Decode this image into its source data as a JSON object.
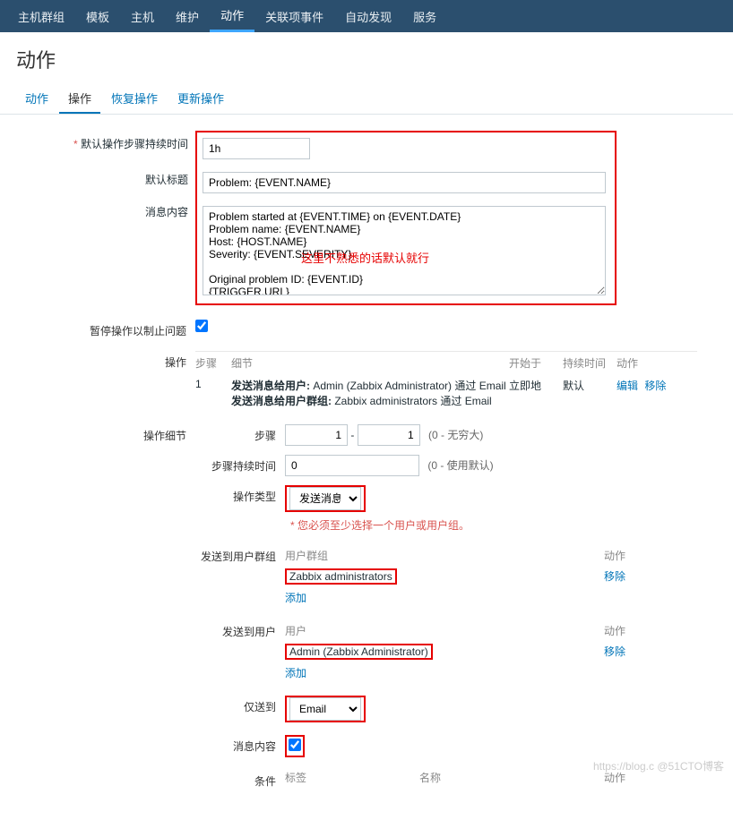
{
  "nav": {
    "items": [
      "主机群组",
      "模板",
      "主机",
      "维护",
      "动作",
      "关联项事件",
      "自动发现",
      "服务"
    ],
    "active_index": 4
  },
  "page_title": "动作",
  "tabs": {
    "items": [
      "动作",
      "操作",
      "恢复操作",
      "更新操作"
    ],
    "active_index": 1
  },
  "labels": {
    "duration": "默认操作步骤持续时间",
    "subject": "默认标题",
    "message": "消息内容",
    "pause": "暂停操作以制止问题",
    "operations": "操作",
    "op_detail": "操作细节",
    "steps": "步骤",
    "step_duration": "步骤持续时间",
    "op_type": "操作类型",
    "send_group": "发送到用户群组",
    "send_user": "发送到用户",
    "only_to": "仅送到",
    "msg_content": "消息内容",
    "conditions": "条件"
  },
  "values": {
    "duration": "1h",
    "subject": "Problem: {EVENT.NAME}",
    "message": "Problem started at {EVENT.TIME} on {EVENT.DATE}\nProblem name: {EVENT.NAME}\nHost: {HOST.NAME}\nSeverity: {EVENT.SEVERITY}\n\nOriginal problem ID: {EVENT.ID}\n{TRIGGER.URL}",
    "pause_checked": true,
    "step_from": "1",
    "step_to": "1",
    "step_duration": "0",
    "op_type": "发送消息",
    "only_to": "Email",
    "msg_checked": true
  },
  "hints": {
    "steps": "(0 - 无穷大)",
    "step_duration": "(0 - 使用默认)",
    "must_select": "您必须至少选择一个用户或用户组。"
  },
  "annotation": "这里不熟悉的话默认就行",
  "ops": {
    "headers": {
      "step": "步骤",
      "detail": "细节",
      "start": "开始于",
      "duration": "持续时间",
      "action": "动作"
    },
    "rows": [
      {
        "step": "1",
        "detail_line1_label": "发送消息给用户:",
        "detail_line1_value": " Admin (Zabbix Administrator) 通过 Email",
        "detail_line2_label": "发送消息给用户群组:",
        "detail_line2_value": " Zabbix administrators 通过 Email",
        "start": "立即地",
        "duration": "默认",
        "edit": "编辑",
        "remove": "移除"
      }
    ]
  },
  "groups": {
    "header_name": "用户群组",
    "header_action": "动作",
    "items": [
      {
        "name": "Zabbix administrators"
      }
    ],
    "remove": "移除",
    "add": "添加"
  },
  "users": {
    "header_name": "用户",
    "header_action": "动作",
    "items": [
      {
        "name": "Admin (Zabbix Administrator)"
      }
    ],
    "remove": "移除",
    "add": "添加"
  },
  "cond_headers": {
    "label": "标签",
    "name": "名称",
    "action": "动作"
  },
  "watermark": "https://blog.c @51CTO博客"
}
